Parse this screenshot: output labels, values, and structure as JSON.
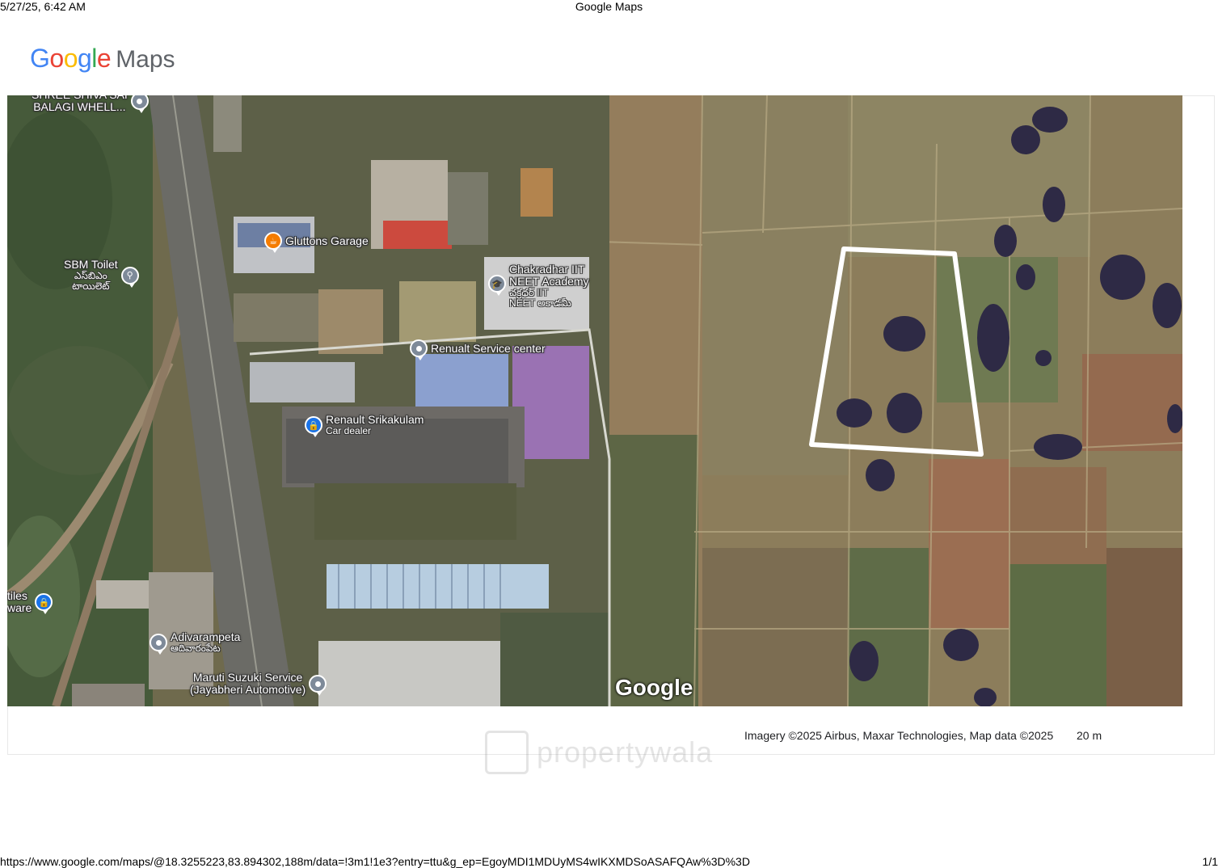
{
  "print_header": {
    "datetime": "5/27/25, 6:42 AM",
    "title": "Google Maps"
  },
  "logo": {
    "letters": [
      {
        "ch": "G",
        "color": "#4285F4"
      },
      {
        "ch": "o",
        "color": "#EA4335"
      },
      {
        "ch": "o",
        "color": "#FBBC05"
      },
      {
        "ch": "g",
        "color": "#4285F4"
      },
      {
        "ch": "l",
        "color": "#34A853"
      },
      {
        "ch": "e",
        "color": "#EA4335"
      }
    ],
    "suffix": "Maps"
  },
  "map": {
    "type": "satellite",
    "brand_watermark": "Google",
    "pois": [
      {
        "id": "balagi",
        "label": "SHREE SHIVA SAI\nBALAGI WHELL...",
        "pin": "grey"
      },
      {
        "id": "gluttons",
        "label": "Gluttons Garage",
        "pin": "orange",
        "icon": "cup-icon"
      },
      {
        "id": "sbm",
        "label": "SBM Toilet",
        "sublabel": "ఎస్‌బిఎం\nటాయిలెట్",
        "pin": "grey",
        "icon": "restroom-icon"
      },
      {
        "id": "chakradhar",
        "label": "Chakradhar IIT\nNEET Academy",
        "sublabel": "చక్రధర్ IIT\nNEET అకాడమీ",
        "pin": "grey",
        "icon": "school-icon"
      },
      {
        "id": "renualt",
        "label": "Renualt Service center",
        "pin": "grey"
      },
      {
        "id": "renault",
        "label": "Renault Srikakulam",
        "sublabel": "Car dealer",
        "pin": "blue",
        "icon": "bag-icon"
      },
      {
        "id": "tiles",
        "label": "tiles\nware",
        "pin": "blue",
        "icon": "bag-icon"
      },
      {
        "id": "adivarampeta",
        "label": "Adivarampeta",
        "sublabel": "ఆదివారంపేట",
        "pin": "grey"
      },
      {
        "id": "maruti",
        "label": "Maruti Suzuki Service\n(Jayabheri Automotive)",
        "pin": "grey"
      }
    ],
    "highlight_area": {
      "shape": "quadrilateral",
      "stroke": "#ffffff"
    }
  },
  "attribution": "Imagery ©2025 Airbus, Maxar Technologies, Map data ©2025",
  "scale_label": "20 m",
  "watermark_text": "propertywala",
  "print_footer": {
    "url": "https://www.google.com/maps/@18.3255223,83.894302,188m/data=!3m1!1e3?entry=ttu&g_ep=EgoyMDI1MDUyMS4wIKXMDSoASAFQAw%3D%3D",
    "page": "1/1"
  }
}
